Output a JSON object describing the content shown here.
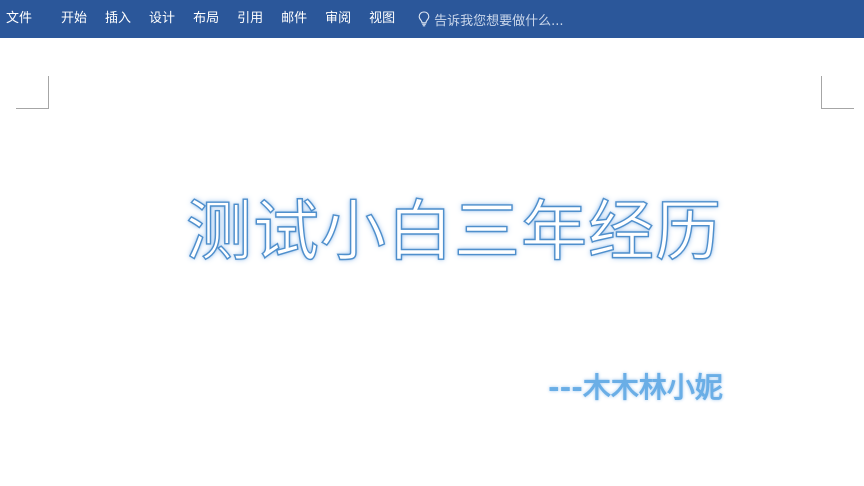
{
  "ribbon": {
    "file_tab": "文件",
    "tabs": [
      {
        "label": "开始"
      },
      {
        "label": "插入"
      },
      {
        "label": "设计"
      },
      {
        "label": "布局"
      },
      {
        "label": "引用"
      },
      {
        "label": "邮件"
      },
      {
        "label": "审阅"
      },
      {
        "label": "视图"
      }
    ],
    "tell_me": "告诉我您想要做什么...",
    "tell_me_icon": "lightbulb-icon",
    "background_color": "#2b579a"
  },
  "document": {
    "title": "测试小白三年经历",
    "author": "---木木林小妮",
    "title_outline_color": "#4f8fcc",
    "author_color": "#6aaee6"
  }
}
